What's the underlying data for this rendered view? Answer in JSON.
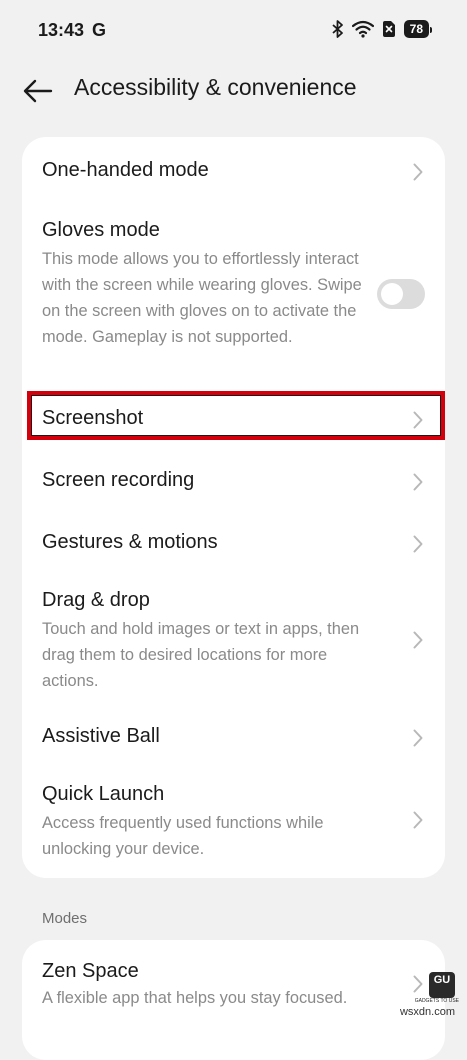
{
  "status_bar": {
    "time": "13:43",
    "notif_letter": "G",
    "battery": "78"
  },
  "app_bar": {
    "title": "Accessibility & convenience"
  },
  "items": [
    {
      "title": "One-handed mode"
    },
    {
      "title": "Gloves mode",
      "desc": "This mode allows you to effortlessly interact with the screen while wearing gloves. Swipe on the screen with gloves on to activate the mode. Gameplay is not supported.",
      "toggle_on": false
    },
    {
      "title": "Screenshot"
    },
    {
      "title": "Screen recording"
    },
    {
      "title": "Gestures & motions"
    },
    {
      "title": "Drag & drop",
      "desc": "Touch and hold images or text in apps, then drag them to desired locations for more actions."
    },
    {
      "title": "Assistive Ball"
    },
    {
      "title": "Quick Launch",
      "desc": "Access frequently used functions while unlocking your device."
    }
  ],
  "modes": {
    "section_label": "Modes",
    "items": [
      {
        "title": "Zen Space",
        "desc": "A flexible app that helps you stay focused."
      }
    ]
  },
  "watermark": {
    "logo": "GU",
    "sub": "GADGETS TO USE",
    "site": "wsxdn.com"
  },
  "colors": {
    "background": "#f1f1f1",
    "card": "#ffffff",
    "highlight": "#d4000b",
    "secondary_text": "#8a8a8a"
  }
}
